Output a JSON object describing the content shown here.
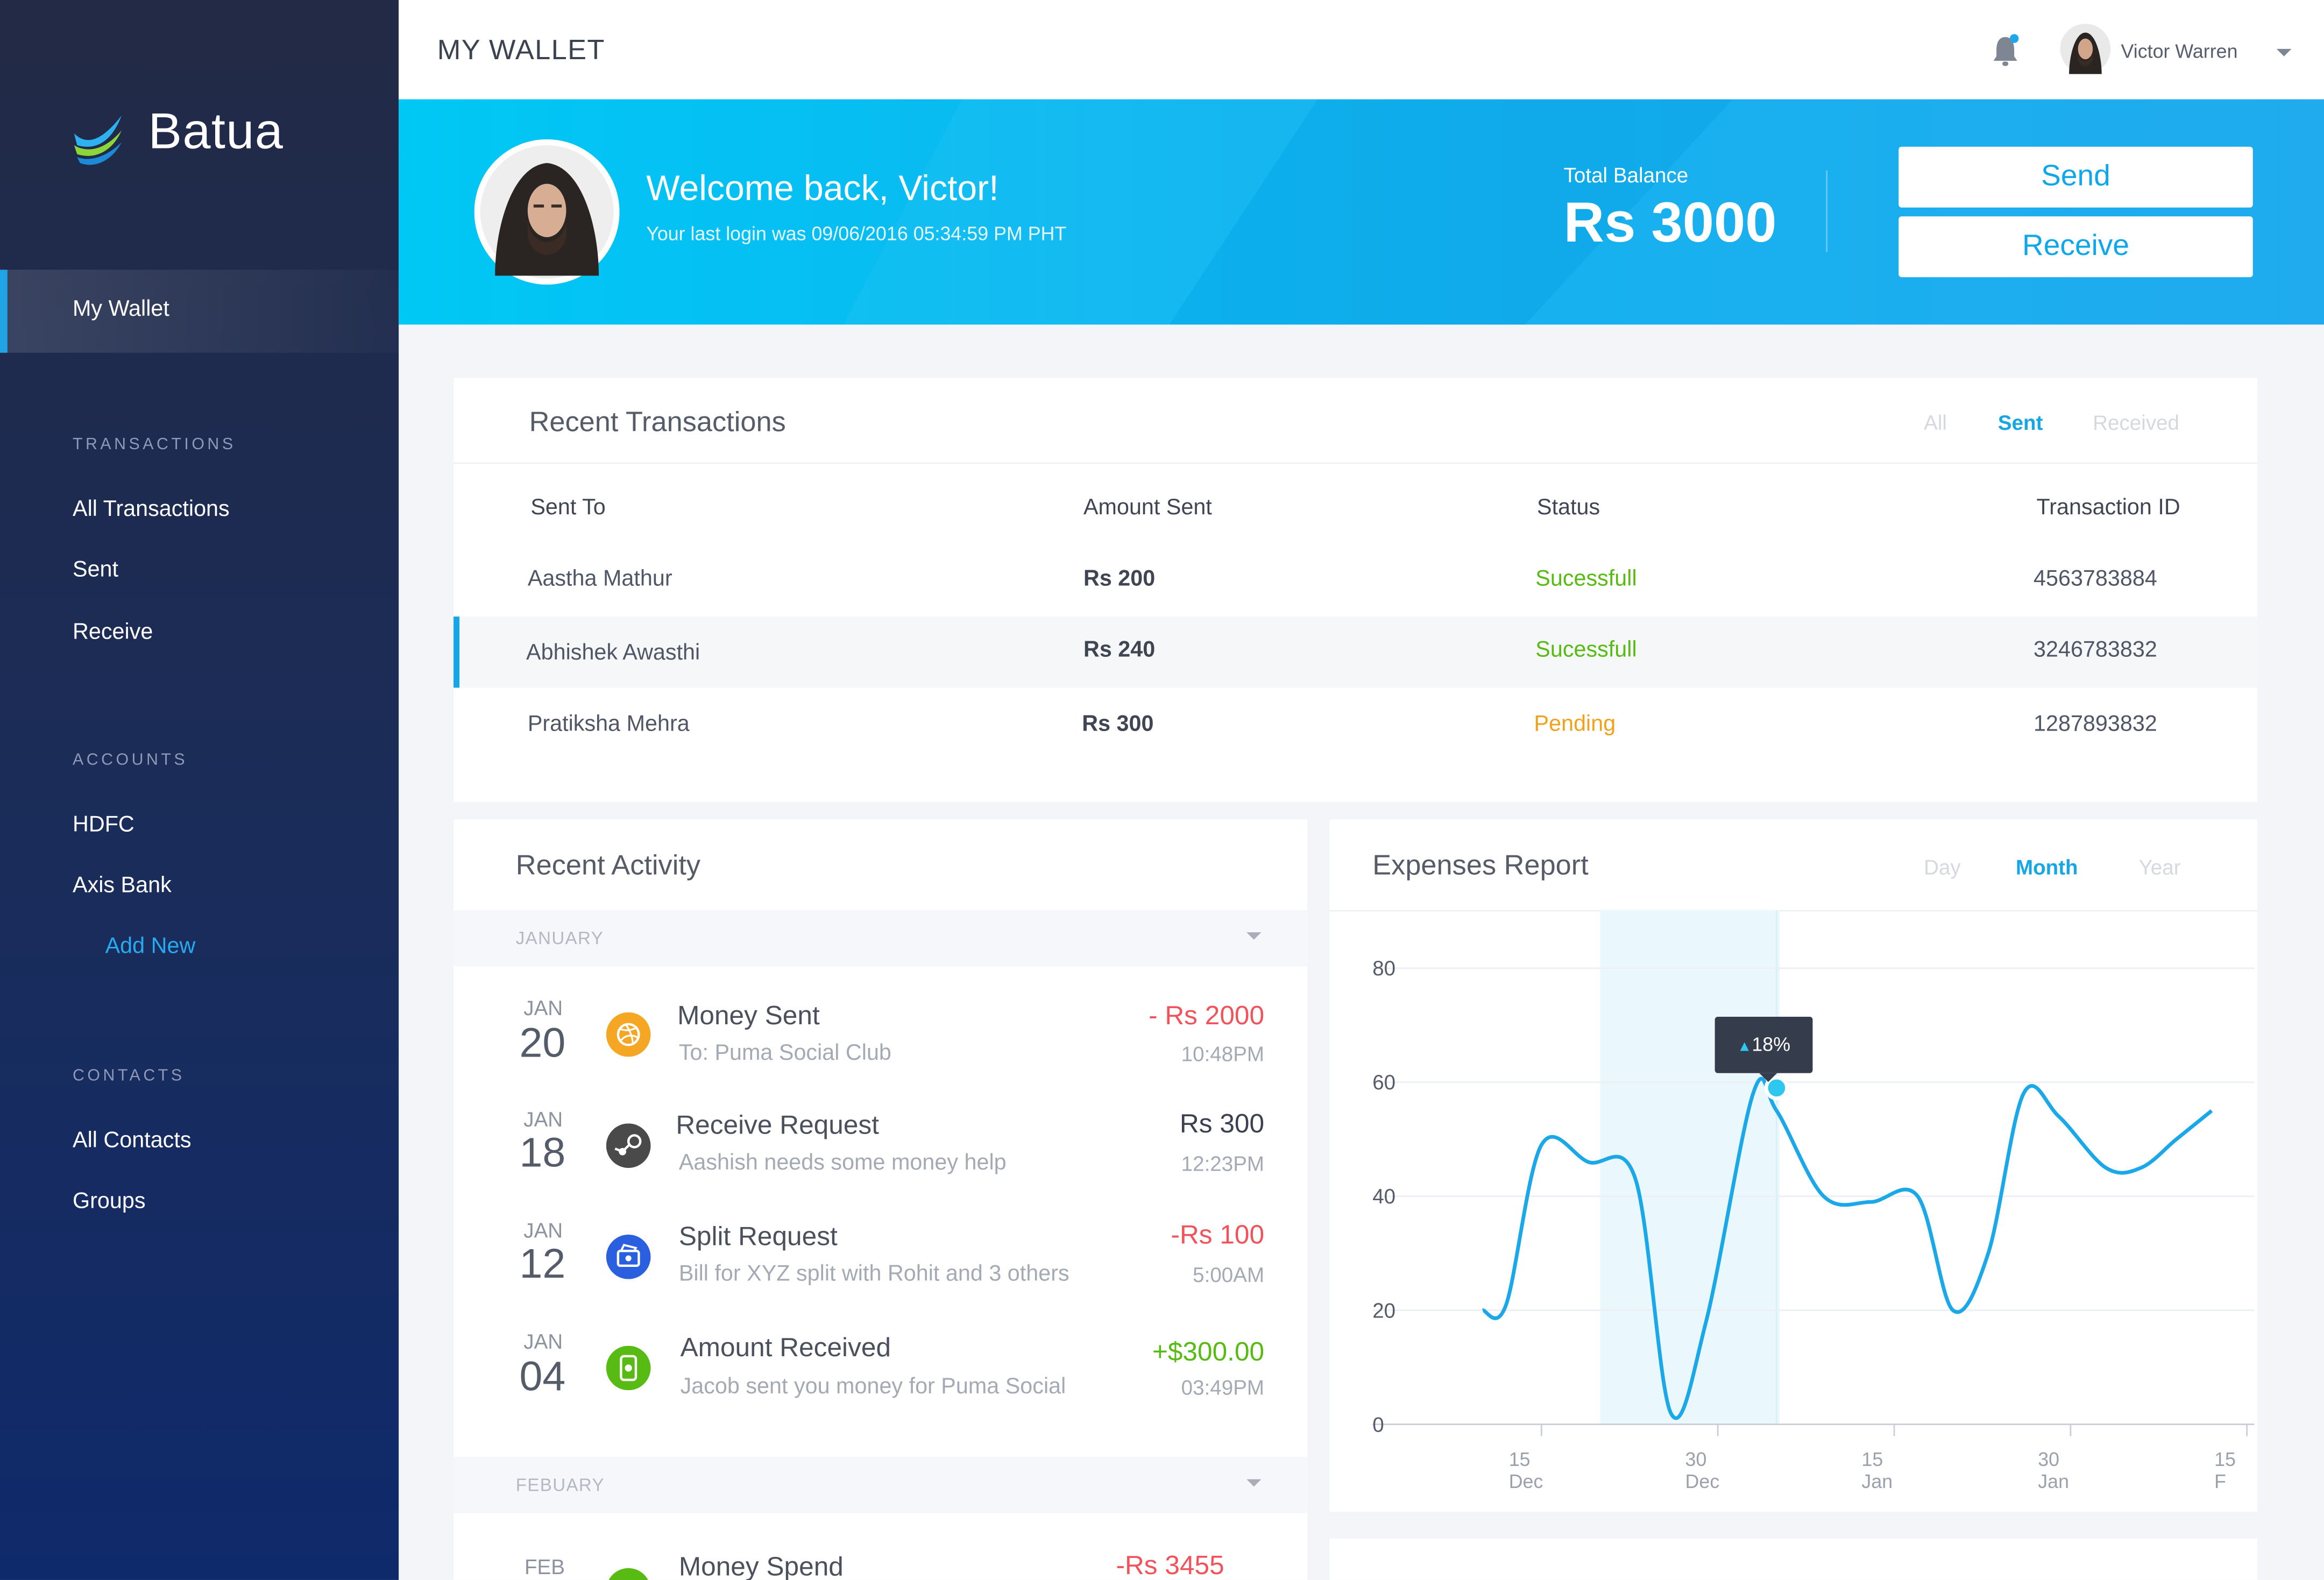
{
  "app": {
    "brand": "Batua",
    "page_title": "MY WALLET"
  },
  "header": {
    "username": "Victor Warren"
  },
  "sidebar": {
    "active_item": "My Wallet",
    "sections": [
      {
        "title": "TRANSACTIONS",
        "items": [
          "All Transactions",
          "Sent",
          "Receive"
        ]
      },
      {
        "title": "ACCOUNTS",
        "items": [
          "HDFC",
          "Axis Bank"
        ],
        "link": "Add New"
      },
      {
        "title": "CONTACTS",
        "items": [
          "All Contacts",
          "Groups"
        ]
      }
    ]
  },
  "banner": {
    "welcome": "Welcome back, Victor!",
    "last_login": "Your last login was 09/06/2016 05:34:59 PM PHT",
    "balance_label": "Total Balance",
    "balance_amount": "Rs 3000",
    "send_label": "Send",
    "receive_label": "Receive"
  },
  "transactions": {
    "title": "Recent Transactions",
    "filters": [
      "All",
      "Sent",
      "Received"
    ],
    "active_filter": "Sent",
    "columns": [
      "Sent To",
      "Amount Sent",
      "Status",
      "Transaction ID"
    ],
    "rows": [
      {
        "name": "Aastha Mathur",
        "amount": "Rs 200",
        "status": "Sucessfull",
        "id": "4563783884"
      },
      {
        "name": "Abhishek Awasthi",
        "amount": "Rs 240",
        "status": "Sucessfull",
        "id": "3246783832"
      },
      {
        "name": "Pratiksha Mehra",
        "amount": "Rs 300",
        "status": "Pending",
        "id": "1287893832"
      }
    ]
  },
  "activity": {
    "title": "Recent Activity",
    "groups": [
      {
        "month": "JANUARY",
        "items": [
          {
            "mon": "JAN",
            "day": "20",
            "icon": "dribbble-icon",
            "title": "Money Sent",
            "sub": "To: Puma Social Club",
            "amount": "- Rs 2000",
            "time": "10:48PM"
          },
          {
            "mon": "JAN",
            "day": "18",
            "icon": "steam-icon",
            "title": "Receive Request",
            "sub": "Aashish needs some money help",
            "amount": "Rs 300",
            "time": "12:23PM"
          },
          {
            "mon": "JAN",
            "day": "12",
            "icon": "bill-icon",
            "title": "Split Request",
            "sub": "Bill for XYZ split with Rohit and 3 others",
            "amount": "-Rs 100",
            "time": "5:00AM"
          },
          {
            "mon": "JAN",
            "day": "04",
            "icon": "phone-money-icon",
            "title": "Amount Received",
            "sub": "Jacob sent you money for Puma Social",
            "amount": "+$300.00",
            "time": "03:49PM"
          }
        ]
      },
      {
        "month": "FEBUARY",
        "items": [
          {
            "mon": "FEB",
            "title": "Money Spend",
            "amount": "-Rs 3455"
          }
        ]
      }
    ]
  },
  "expenses": {
    "title": "Expenses Report",
    "filters": [
      "Day",
      "Month",
      "Year"
    ],
    "active_filter": "Month",
    "tooltip": "18%"
  },
  "colors": {
    "accent": "#15a6e6",
    "success": "#58bb13",
    "pending": "#f2a11c",
    "negative": "#f2535b",
    "sidebar": "#1a2c5a"
  },
  "chart_data": {
    "type": "line",
    "title": "Expenses Report",
    "x_ticks": [
      "15 Dec",
      "30 Dec",
      "15 Jan",
      "30 Jan",
      "15 F"
    ],
    "y_ticks": [
      "0",
      "20",
      "40",
      "60",
      "80"
    ],
    "ylim": [
      0,
      85
    ],
    "grid": true,
    "series": [
      {
        "x": [
          -5,
          -3,
          0,
          4,
          8,
          11,
          14,
          18,
          20,
          24,
          28,
          32,
          35,
          38,
          41,
          44,
          48,
          51,
          54,
          57
        ],
        "values": [
          20,
          21,
          49,
          46,
          43,
          2,
          18,
          58,
          55,
          40,
          39,
          40,
          20,
          30,
          58,
          54,
          45,
          45,
          50,
          55
        ]
      }
    ],
    "highlight": {
      "x": 20,
      "y": 59,
      "label": "18%",
      "direction": "up"
    }
  }
}
